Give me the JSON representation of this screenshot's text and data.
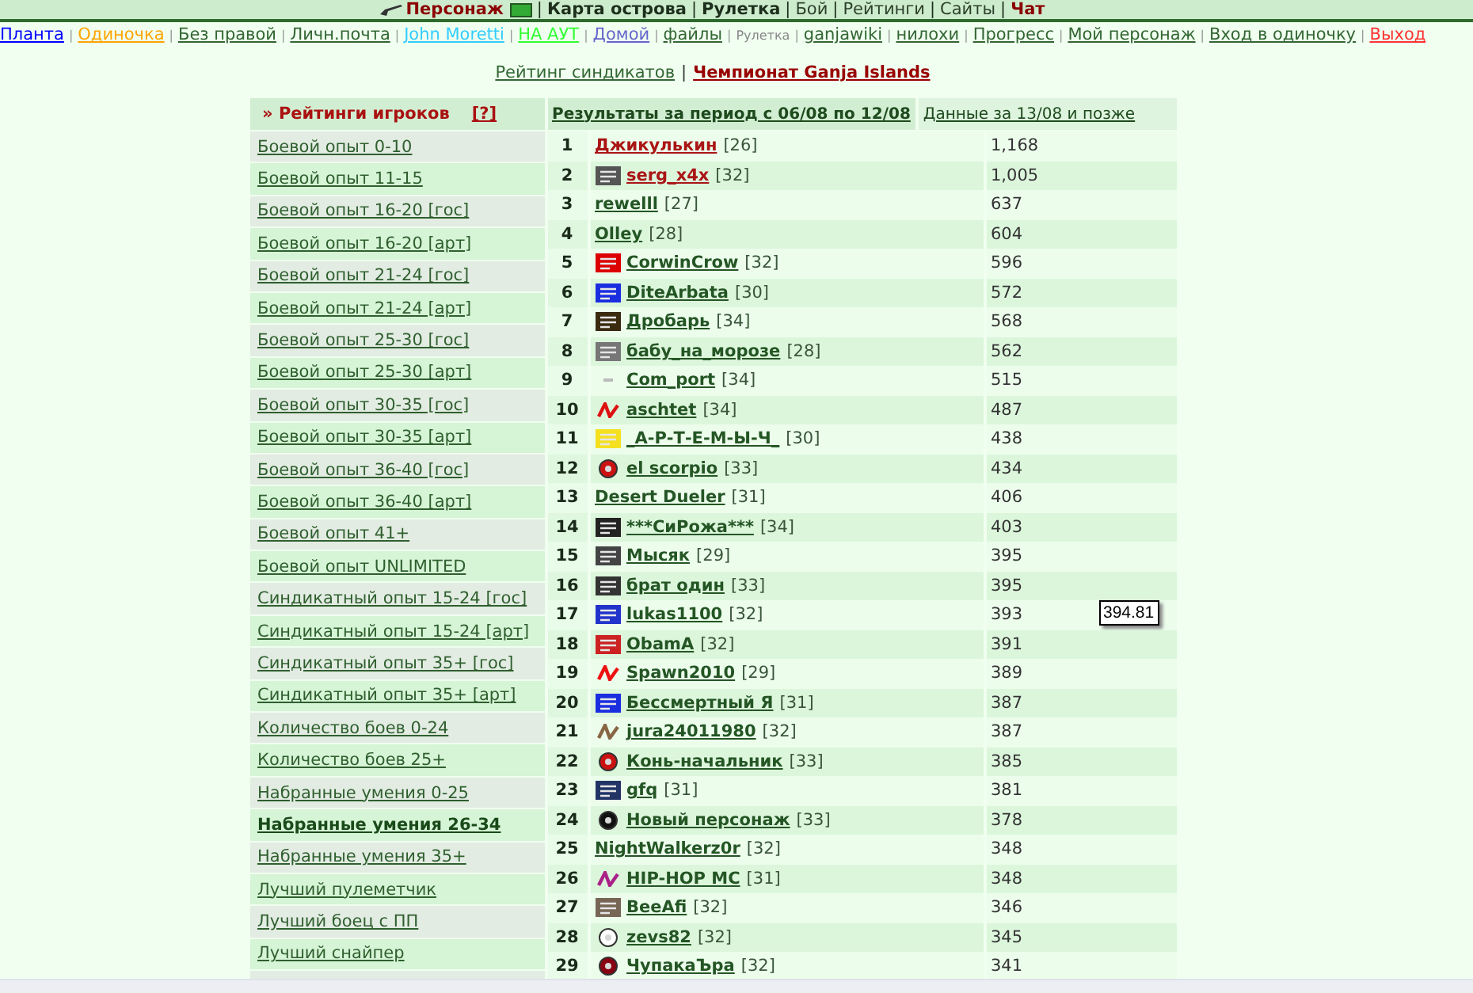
{
  "top_menu": {
    "separator": "|",
    "items": [
      {
        "label": "Персонаж",
        "kind": "character",
        "bold": true,
        "color": "#8b0000"
      },
      {
        "label": "Карта острова",
        "kind": "link",
        "bold": true,
        "color": "#1c2e1c"
      },
      {
        "label": "Рулетка",
        "kind": "link",
        "bold": true,
        "color": "#1c2e1c"
      },
      {
        "label": "Бой",
        "kind": "link",
        "bold": false,
        "color": "#2c402c"
      },
      {
        "label": "Рейтинги",
        "kind": "link",
        "bold": false,
        "color": "#2c402c"
      },
      {
        "label": "Сайты",
        "kind": "link",
        "bold": false,
        "color": "#2c402c"
      },
      {
        "label": "Чат",
        "kind": "link",
        "bold": true,
        "color": "#8b0000"
      }
    ]
  },
  "nav": {
    "separator": "|",
    "items": [
      {
        "label": "Планта",
        "kind": "link",
        "color": "#0000ff"
      },
      {
        "label": "Одиночка",
        "kind": "link",
        "color": "#ffa500"
      },
      {
        "label": "Без правой",
        "kind": "link",
        "color": "#336633"
      },
      {
        "label": "Личн.почта",
        "kind": "link",
        "color": "#336633"
      },
      {
        "label": "John Moretti",
        "kind": "link",
        "color": "#33ccff"
      },
      {
        "label": "НА АУТ",
        "kind": "link",
        "color": "#33ff33"
      },
      {
        "label": "Домой",
        "kind": "link",
        "color": "#6666cc"
      },
      {
        "label": "файлы",
        "kind": "link",
        "color": "#336633"
      },
      {
        "label": "Рулетка",
        "kind": "text",
        "color": "#888888"
      },
      {
        "label": "ganjawiki",
        "kind": "link",
        "color": "#336633"
      },
      {
        "label": "нилохи",
        "kind": "link",
        "color": "#336633"
      },
      {
        "label": "Прогресс",
        "kind": "link",
        "color": "#336633"
      },
      {
        "label": "Мой персонаж",
        "kind": "link",
        "color": "#336633"
      },
      {
        "label": "Вход в одиночку",
        "kind": "link",
        "color": "#336633"
      },
      {
        "label": "Выход",
        "kind": "link",
        "color": "#ff3333"
      }
    ]
  },
  "subnav": {
    "separator": "|",
    "items": [
      {
        "label": "Рейтинг синдикатов",
        "bold": false,
        "color": "#336633"
      },
      {
        "label": "Чемпионат Ganja Islands",
        "bold": true,
        "color": "#990000"
      }
    ]
  },
  "sidebar": {
    "title": "» Рейтинги игроков",
    "help": "[?]",
    "items": [
      {
        "label": "Боевой опыт 0-10",
        "selected": false
      },
      {
        "label": "Боевой опыт 11-15",
        "selected": false
      },
      {
        "label": "Боевой опыт 16-20 [гос]",
        "selected": false
      },
      {
        "label": "Боевой опыт 16-20 [арт]",
        "selected": false
      },
      {
        "label": "Боевой опыт 21-24 [гос]",
        "selected": false
      },
      {
        "label": "Боевой опыт 21-24 [арт]",
        "selected": false
      },
      {
        "label": "Боевой опыт 25-30 [гос]",
        "selected": false
      },
      {
        "label": "Боевой опыт 25-30 [арт]",
        "selected": false
      },
      {
        "label": "Боевой опыт 30-35 [гос]",
        "selected": false
      },
      {
        "label": "Боевой опыт 30-35 [арт]",
        "selected": false
      },
      {
        "label": "Боевой опыт 36-40 [гос]",
        "selected": false
      },
      {
        "label": "Боевой опыт 36-40 [арт]",
        "selected": false
      },
      {
        "label": "Боевой опыт 41+",
        "selected": false
      },
      {
        "label": "Боевой опыт UNLIMITED",
        "selected": false
      },
      {
        "label": "Синдикатный опыт 15-24 [гос]",
        "selected": false
      },
      {
        "label": "Синдикатный опыт 15-24 [арт]",
        "selected": false
      },
      {
        "label": "Синдикатный опыт 35+ [гос]",
        "selected": false
      },
      {
        "label": "Синдикатный опыт 35+ [арт]",
        "selected": false
      },
      {
        "label": "Количество боев 0-24",
        "selected": false
      },
      {
        "label": "Количество боев 25+",
        "selected": false
      },
      {
        "label": "Набранные умения 0-25",
        "selected": false
      },
      {
        "label": "Набранные умения 26-34",
        "selected": true
      },
      {
        "label": "Набранные умения 35+",
        "selected": false
      },
      {
        "label": "Лучший пулеметчик",
        "selected": false
      },
      {
        "label": "Лучший боец с ПП",
        "selected": false
      },
      {
        "label": "Лучший снайпер",
        "selected": false
      }
    ]
  },
  "results": {
    "columns": [
      {
        "label": "Результаты за период с 06/08 по 12/08",
        "bold": true
      },
      {
        "label": "Данные за 13/08 и позже",
        "bold": false
      }
    ],
    "rows": [
      {
        "rank": "1",
        "name": "Джикулькин",
        "level_label": "[26]",
        "value": "1,168",
        "highlighted": true
      },
      {
        "rank": "2",
        "name": "serg_x4x",
        "level_label": "[32]",
        "value": "1,005",
        "highlighted": true,
        "emblem": {
          "kind": "tile",
          "color": "#555555"
        }
      },
      {
        "rank": "3",
        "name": "rewelll",
        "level_label": "[27]",
        "value": "637",
        "highlighted": false
      },
      {
        "rank": "4",
        "name": "Olley",
        "level_label": "[28]",
        "value": "604",
        "highlighted": false
      },
      {
        "rank": "5",
        "name": "CorwinCrow",
        "level_label": "[32]",
        "value": "596",
        "highlighted": false,
        "emblem": {
          "kind": "tile",
          "color": "#dd0000"
        }
      },
      {
        "rank": "6",
        "name": "DiteArbata",
        "level_label": "[30]",
        "value": "572",
        "highlighted": false,
        "emblem": {
          "kind": "tile",
          "color": "#1a2ee0"
        }
      },
      {
        "rank": "7",
        "name": "Дробарь",
        "level_label": "[34]",
        "value": "568",
        "highlighted": false,
        "emblem": {
          "kind": "tile",
          "color": "#3a2a10"
        }
      },
      {
        "rank": "8",
        "name": "бабу_на_морозе",
        "level_label": "[28]",
        "value": "562",
        "highlighted": false,
        "emblem": {
          "kind": "tile",
          "color": "#777777"
        }
      },
      {
        "rank": "9",
        "name": "Com_port",
        "level_label": "[34]",
        "value": "515",
        "highlighted": false,
        "emblem": {
          "kind": "dash",
          "color": "#bbbbbb"
        }
      },
      {
        "rank": "10",
        "name": "aschtet",
        "level_label": "[34]",
        "value": "487",
        "highlighted": false,
        "emblem": {
          "kind": "mark",
          "color": "#dd1111"
        }
      },
      {
        "rank": "11",
        "name": "_А-Р-Т-Е-М-Ы-Ч_",
        "level_label": "[30]",
        "value": "438",
        "highlighted": false,
        "emblem": {
          "kind": "tile",
          "color": "#f5e020"
        }
      },
      {
        "rank": "12",
        "name": "el scorpio",
        "level_label": "[33]",
        "value": "434",
        "highlighted": false,
        "emblem": {
          "kind": "round",
          "color": "#cc1111"
        }
      },
      {
        "rank": "13",
        "name": "Desert Dueler",
        "level_label": "[31]",
        "value": "406",
        "highlighted": false
      },
      {
        "rank": "14",
        "name": "***СиРожа***",
        "level_label": "[34]",
        "value": "403",
        "highlighted": false,
        "emblem": {
          "kind": "tile",
          "color": "#222222"
        }
      },
      {
        "rank": "15",
        "name": "Мысяк",
        "level_label": "[29]",
        "value": "395",
        "highlighted": false,
        "emblem": {
          "kind": "tile",
          "color": "#444444"
        }
      },
      {
        "rank": "16",
        "name": "брат один",
        "level_label": "[33]",
        "value": "395",
        "highlighted": false,
        "emblem": {
          "kind": "tile",
          "color": "#333333"
        }
      },
      {
        "rank": "17",
        "name": "lukas1100",
        "level_label": "[32]",
        "value": "393",
        "highlighted": false,
        "emblem": {
          "kind": "tile",
          "color": "#2233cc"
        },
        "tooltip": "394.81"
      },
      {
        "rank": "18",
        "name": "ObamA",
        "level_label": "[32]",
        "value": "391",
        "highlighted": false,
        "emblem": {
          "kind": "tile",
          "color": "#cc2222"
        }
      },
      {
        "rank": "19",
        "name": "Spawn2010",
        "level_label": "[29]",
        "value": "389",
        "highlighted": false,
        "emblem": {
          "kind": "mark",
          "color": "#ee1111"
        }
      },
      {
        "rank": "20",
        "name": "Бессмертный Я",
        "level_label": "[31]",
        "value": "387",
        "highlighted": false,
        "emblem": {
          "kind": "tile",
          "color": "#1a2ee0"
        }
      },
      {
        "rank": "21",
        "name": "jura24011980",
        "level_label": "[32]",
        "value": "387",
        "highlighted": false,
        "emblem": {
          "kind": "mark",
          "color": "#886644"
        }
      },
      {
        "rank": "22",
        "name": "Конь-начальник",
        "level_label": "[33]",
        "value": "385",
        "highlighted": false,
        "emblem": {
          "kind": "round",
          "color": "#cc1111"
        }
      },
      {
        "rank": "23",
        "name": "gfq",
        "level_label": "[31]",
        "value": "381",
        "highlighted": false,
        "emblem": {
          "kind": "tile",
          "color": "#223366"
        }
      },
      {
        "rank": "24",
        "name": "Новый персонаж",
        "level_label": "[33]",
        "value": "378",
        "highlighted": false,
        "emblem": {
          "kind": "round",
          "color": "#111111"
        }
      },
      {
        "rank": "25",
        "name": "NightWalkerz0r",
        "level_label": "[32]",
        "value": "348",
        "highlighted": false
      },
      {
        "rank": "26",
        "name": "HIP-HOP MC",
        "level_label": "[31]",
        "value": "348",
        "highlighted": false,
        "emblem": {
          "kind": "mark",
          "color": "#aa2288"
        }
      },
      {
        "rank": "27",
        "name": "BeeAfi",
        "level_label": "[32]",
        "value": "346",
        "highlighted": false,
        "emblem": {
          "kind": "tile",
          "color": "#776655"
        }
      },
      {
        "rank": "28",
        "name": "zevs82",
        "level_label": "[32]",
        "value": "345",
        "highlighted": false,
        "emblem": {
          "kind": "round",
          "color": "#ffffff"
        }
      },
      {
        "rank": "29",
        "name": "ЧупакаЪра",
        "level_label": "[32]",
        "value": "341",
        "highlighted": false,
        "emblem": {
          "kind": "round",
          "color": "#880011"
        }
      }
    ]
  }
}
